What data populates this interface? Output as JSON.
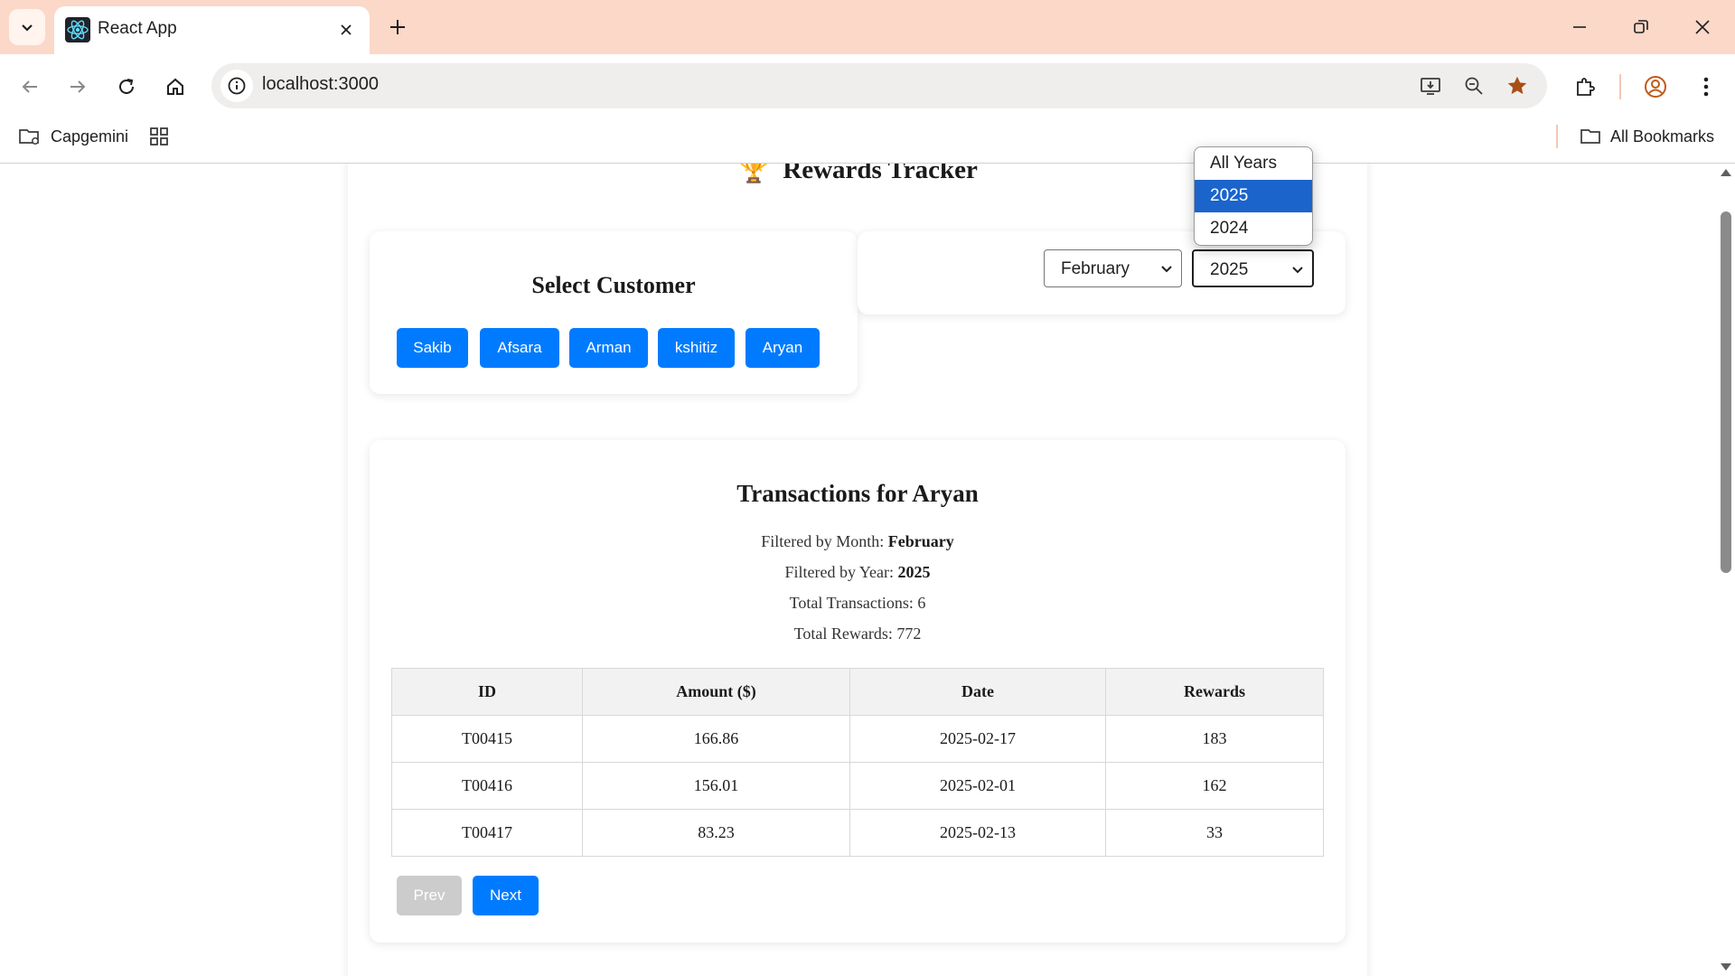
{
  "browser": {
    "tab_title": "React App",
    "url": "localhost:3000",
    "bookmarks": [
      {
        "label": "Capgemini",
        "icon": "folder-gear-icon"
      },
      {
        "label": "",
        "icon": "apps-grid-icon"
      }
    ],
    "all_bookmarks_label": "All Bookmarks"
  },
  "app": {
    "title": "Rewards Tracker",
    "title_icon": "🏆",
    "customer_panel": {
      "title": "Select Customer",
      "customers": [
        "Sakib",
        "Afsara",
        "Arman",
        "kshitiz",
        "Aryan"
      ]
    },
    "filters": {
      "month_value": "February",
      "year_value": "2025",
      "year_options": [
        "All Years",
        "2025",
        "2024"
      ],
      "year_highlighted": "2025"
    },
    "transactions": {
      "title": "Transactions for Aryan",
      "month_label": "Filtered by Month:",
      "month_value": "February",
      "year_label": "Filtered by Year:",
      "year_value": "2025",
      "total_transactions": "Total Transactions: 6",
      "total_rewards": "Total Rewards: 772",
      "columns": [
        "ID",
        "Amount ($)",
        "Date",
        "Rewards"
      ],
      "rows": [
        [
          "T00415",
          "166.86",
          "2025-02-17",
          "183"
        ],
        [
          "T00416",
          "156.01",
          "2025-02-01",
          "162"
        ],
        [
          "T00417",
          "83.23",
          "2025-02-13",
          "33"
        ]
      ],
      "prev_label": "Prev",
      "next_label": "Next"
    }
  },
  "colors": {
    "tabstrip": "#fbd8c8",
    "primary_button": "#007bff",
    "disabled_button": "#cccccc",
    "dropdown_highlight": "#1a64cc"
  }
}
